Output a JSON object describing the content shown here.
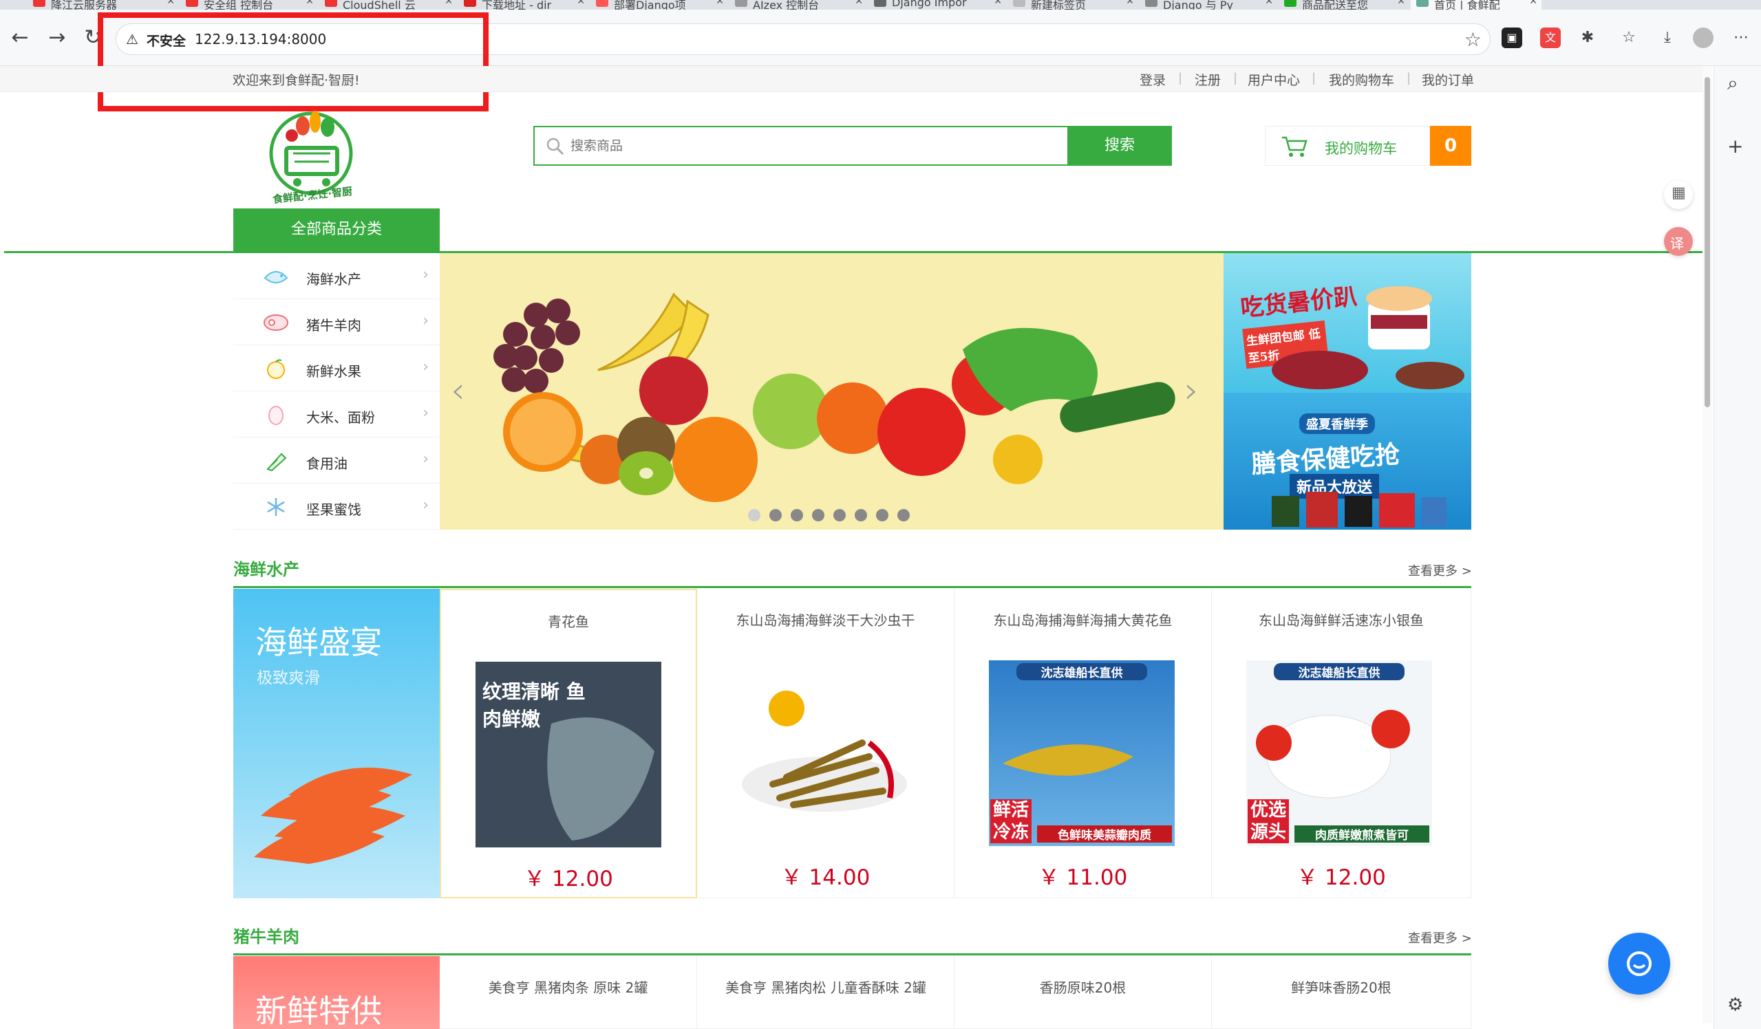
{
  "browser": {
    "tabs": [
      "降江云服务器",
      "安全组 控制台",
      "CloudShell 云",
      "下载地址 - dir",
      "部署Django项",
      "AIzex 控制台",
      "Django Impor",
      "新建标签页",
      "Django 与 Py",
      "商品配送至您",
      "首页 | 食鲜配"
    ],
    "security_label": "不安全",
    "url": "122.9.13.194:8000"
  },
  "site_top": {
    "welcome": "欢迎来到食鲜配·智厨!",
    "links": [
      "登录",
      "注册",
      "用户中心",
      "我的购物车",
      "我的订单"
    ]
  },
  "header": {
    "logo_text": "食鲜配·烹饪·智厨",
    "search_placeholder": "搜索商品",
    "search_button": "搜索",
    "cart_label": "我的购物车",
    "cart_count": "0"
  },
  "nav": {
    "all_categories": "全部商品分类"
  },
  "categories": [
    {
      "label": "海鲜水产",
      "icon": "fish-icon"
    },
    {
      "label": "猪牛羊肉",
      "icon": "meat-icon"
    },
    {
      "label": "新鲜水果",
      "icon": "fruit-icon"
    },
    {
      "label": "大米、面粉",
      "icon": "egg-icon"
    },
    {
      "label": "食用油",
      "icon": "vegetable-icon"
    },
    {
      "label": "坚果蜜饯",
      "icon": "snowflake-icon"
    }
  ],
  "banner": {
    "slides": 8,
    "active_slide": 1
  },
  "ads": {
    "ad1_title": "吃货暑价趴",
    "ad1_sub": "生鲜团包邮 低至5折",
    "ad2_title": "盛夏香鲜季",
    "ad2_main": "膳食保健吃抢",
    "ad2_sub": "新品大放送"
  },
  "sections": [
    {
      "title": "海鲜水产",
      "more": "查看更多 >",
      "promo_big": "海鲜盛宴",
      "promo_small": "极致爽滑",
      "products": [
        {
          "name": "青花鱼",
          "price": "￥ 12.00",
          "img_tag": "纹理清晰 鱼肉鲜嫩"
        },
        {
          "name": "东山岛海捕海鲜淡干大沙虫干",
          "price": "￥ 14.00",
          "img_tag": ""
        },
        {
          "name": "东山岛海捕海鲜海捕大黄花鱼",
          "price": "￥ 11.00",
          "img_tag": "沈志雄船长直供",
          "img_tag2": "鲜活冷冻",
          "img_tag3": "色鲜味美蒜瓣肉质"
        },
        {
          "name": "东山岛海鲜鲜活速冻小银鱼",
          "price": "￥ 12.00",
          "img_tag": "沈志雄船长直供",
          "img_tag2": "优选源头",
          "img_tag3": "肉质鲜嫩煎煮皆可"
        }
      ]
    },
    {
      "title": "猪牛羊肉",
      "more": "查看更多 >",
      "promo_big": "新鲜特供",
      "products": [
        {
          "name": "美食亨 黑猪肉条 原味 2罐"
        },
        {
          "name": "美食亨 黑猪肉松 儿童香酥味 2罐"
        },
        {
          "name": "香肠原味20根"
        },
        {
          "name": "鲜笋味香肠20根"
        }
      ]
    }
  ],
  "colors": {
    "brand_green": "#37ab40",
    "cart_orange": "#ff8a00",
    "price_red": "#d0021b",
    "highlight_red": "#ee1c1c"
  }
}
